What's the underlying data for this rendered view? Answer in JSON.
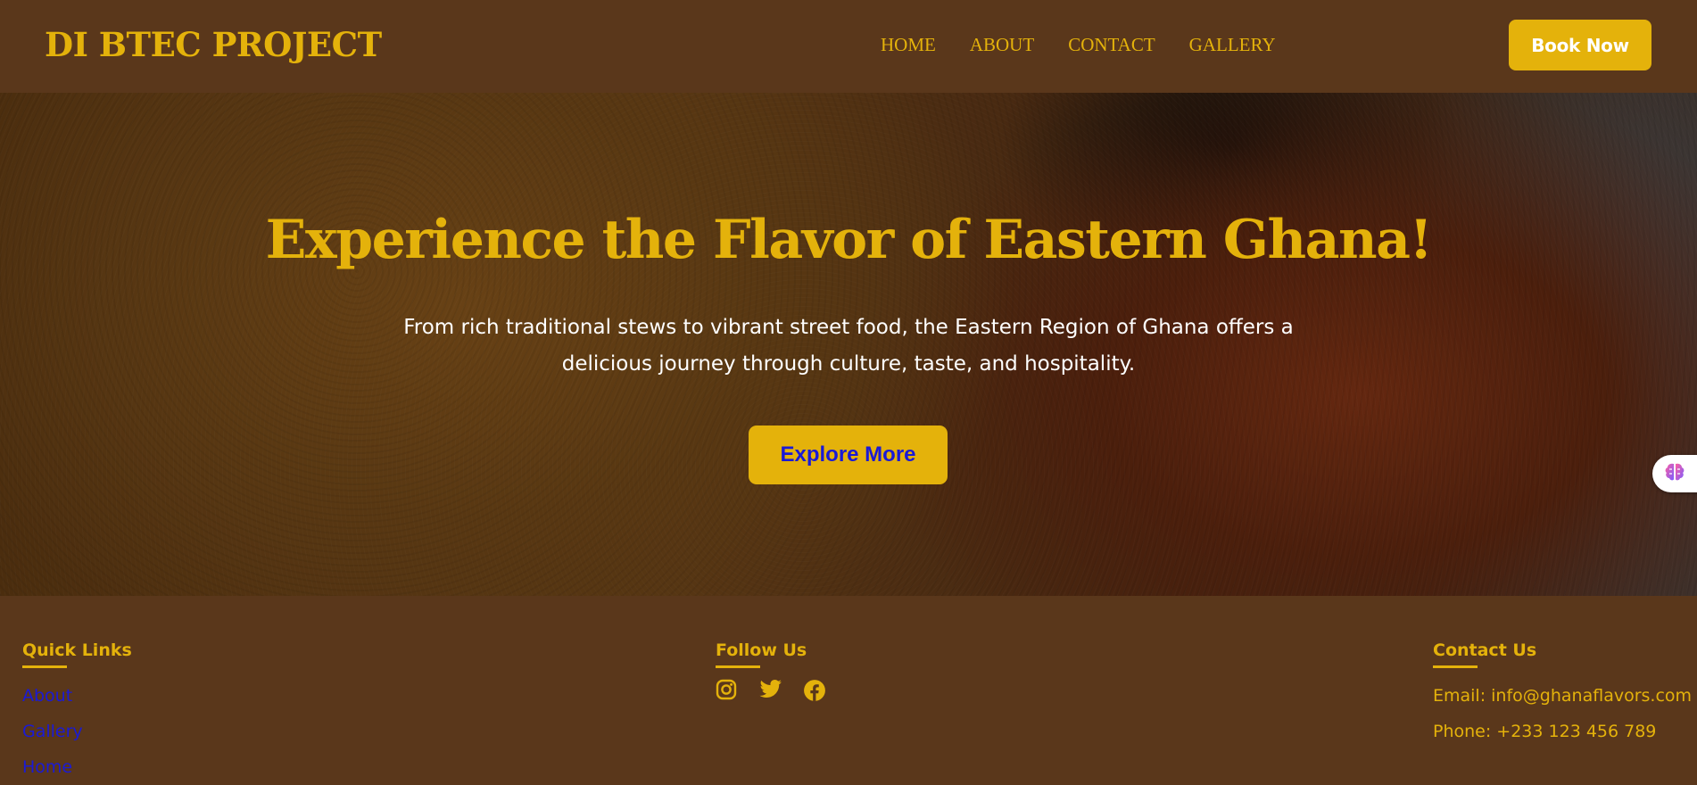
{
  "header": {
    "brand": "DI BTEC PROJECT",
    "nav": [
      "HOME",
      "ABOUT",
      "CONTACT",
      "GALLERY"
    ],
    "book_button": "Book Now"
  },
  "hero": {
    "title": "Experience the Flavor of Eastern Ghana!",
    "subtitle": "From rich traditional stews to vibrant street food, the Eastern Region of Ghana offers a delicious journey through culture, taste, and hospitality.",
    "cta": "Explore More"
  },
  "footer": {
    "quick_links": {
      "heading": "Quick Links",
      "links": [
        "About",
        "Gallery",
        "Home"
      ]
    },
    "follow": {
      "heading": "Follow Us",
      "icons": [
        "instagram-icon",
        "twitter-icon",
        "facebook-icon"
      ]
    },
    "contact": {
      "heading": "Contact Us",
      "email": "Email: info@ghanaflavors.com",
      "phone": "Phone: +233 123 456 789"
    }
  },
  "side_widget": {
    "icon": "brain-icon"
  },
  "colors": {
    "background": "#5a371b",
    "accent": "#e4b20b",
    "link": "#1a1ad6",
    "text_light": "#ffffff"
  }
}
